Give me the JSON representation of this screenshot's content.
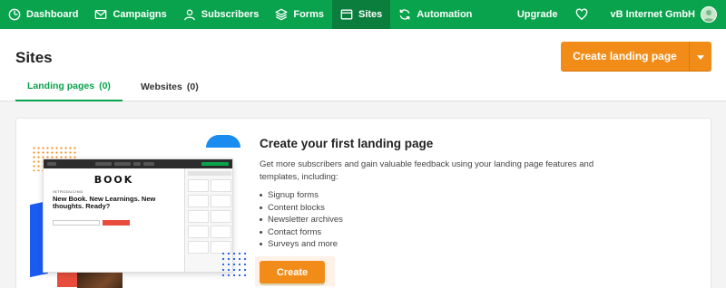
{
  "nav": {
    "items": [
      {
        "label": "Dashboard",
        "icon": "gauge-icon"
      },
      {
        "label": "Campaigns",
        "icon": "envelope-icon"
      },
      {
        "label": "Subscribers",
        "icon": "user-icon"
      },
      {
        "label": "Forms",
        "icon": "layers-icon"
      },
      {
        "label": "Sites",
        "icon": "browser-icon"
      },
      {
        "label": "Automation",
        "icon": "refresh-icon"
      }
    ],
    "active": "Sites",
    "upgrade_label": "Upgrade",
    "account_name": "vB Internet GmbH"
  },
  "header": {
    "title": "Sites",
    "create_button_label": "Create landing page",
    "tabs": [
      {
        "label": "Landing pages",
        "count": "(0)"
      },
      {
        "label": "Websites",
        "count": "(0)"
      }
    ]
  },
  "empty_state": {
    "title": "Create your first landing page",
    "description": "Get more subscribers and gain valuable feedback using your landing page features and templates, including:",
    "features": [
      "Signup forms",
      "Content blocks",
      "Newsletter archives",
      "Contact forms",
      "Surveys and more"
    ],
    "button_label": "Create"
  },
  "illustration": {
    "logo": "BOOK",
    "intro": "INTRODUCING",
    "headline": "New Book. New Learnings. New thoughts. Ready?"
  },
  "colors": {
    "brand_green": "#09a34d",
    "active_nav": "#0b7d3d",
    "accent_orange": "#f28c18"
  }
}
